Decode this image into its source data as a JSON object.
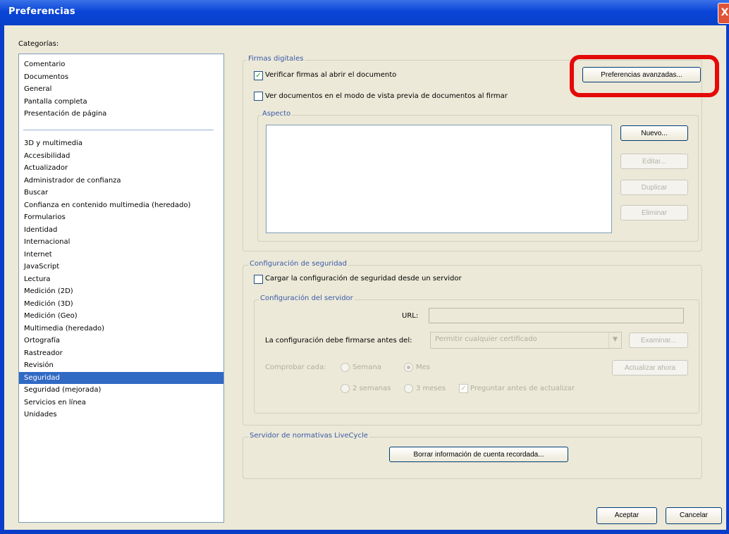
{
  "window": {
    "title": "Preferencias",
    "close_label": "X"
  },
  "categories": {
    "label": "Categorías:",
    "group1": [
      "Comentario",
      "Documentos",
      "General",
      "Pantalla completa",
      "Presentación de página"
    ],
    "group2": [
      "3D y multimedia",
      "Accesibilidad",
      "Actualizador",
      "Administrador de confianza",
      "Buscar",
      "Confianza en contenido multimedia (heredado)",
      "Formularios",
      "Identidad",
      "Internacional",
      "Internet",
      "JavaScript",
      "Lectura",
      "Medición (2D)",
      "Medición (3D)",
      "Medición (Geo)",
      "Multimedia (heredado)",
      "Ortografía",
      "Rastreador",
      "Revisión",
      "Seguridad",
      "Seguridad (mejorada)",
      "Servicios en línea",
      "Unidades"
    ],
    "selected": "Seguridad"
  },
  "firmas": {
    "title": "Firmas digitales",
    "verificar_label": "Verificar firmas al abrir el documento",
    "verificar_checked": true,
    "ver_label": "Ver documentos en el modo de vista previa de documentos al firmar",
    "ver_checked": false,
    "advanced_button": "Preferencias avanzadas...",
    "aspecto": {
      "title": "Aspecto",
      "nuevo": "Nuevo...",
      "editar": "Editar...",
      "duplicar": "Duplicar",
      "eliminar": "Eliminar"
    }
  },
  "seguridad": {
    "title": "Configuración de seguridad",
    "cargar_label": "Cargar la configuración de seguridad desde un servidor",
    "cargar_checked": false,
    "servidor": {
      "title": "Configuración del servidor",
      "url_label": "URL:",
      "url_value": "",
      "firmar_label": "La configuración debe firmarse antes del:",
      "firmar_value": "Permitir cualquier certificado",
      "examinar": "Examinar...",
      "comprobar_label": "Comprobar cada:",
      "semana": "Semana",
      "mes": "Mes",
      "dos_semanas": "2 semanas",
      "tres_meses": "3 meses",
      "preguntar": "Preguntar antes de actualizar",
      "actualizar": "Actualizar ahora"
    }
  },
  "livecycle": {
    "title": "Servidor de normativas LiveCycle",
    "borrar_button": "Borrar información de cuenta recordada..."
  },
  "footer": {
    "aceptar": "Aceptar",
    "cancelar": "Cancelar"
  },
  "colors": {
    "highlight": "#e50a0a",
    "selection": "#316ac5",
    "titlebar": "#0a45d8"
  }
}
